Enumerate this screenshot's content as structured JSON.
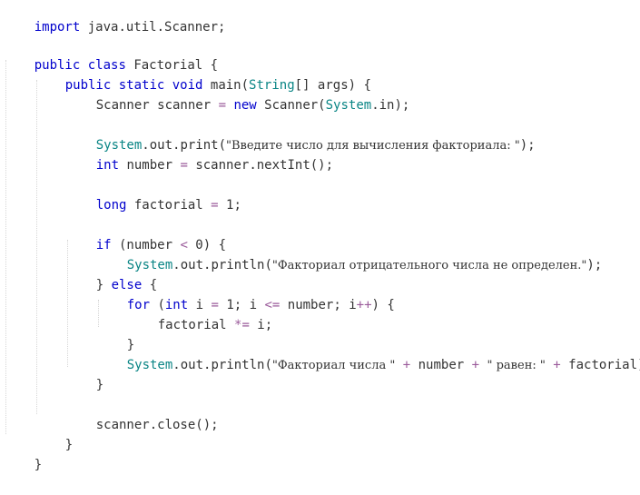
{
  "colors": {
    "keyword": "#0000cc",
    "type": "#0a8585",
    "operator": "#9a5a9a",
    "text": "#333333",
    "background": "#ffffff"
  },
  "code": {
    "l1": {
      "kw": "import",
      "rest": " java.util.Scanner;"
    },
    "l3": {
      "kw1": "public",
      "kw2": "class",
      "name": " Factorial {"
    },
    "l4": {
      "kw1": "public",
      "kw2": "static",
      "kw3": "void",
      "m": " main(",
      "type": "String",
      "rest": "[] args) {"
    },
    "l5": {
      "a": "Scanner scanner ",
      "eq": "=",
      "kw": "new",
      "b": " Scanner(",
      "sys": "System",
      "c": ".in);"
    },
    "l7": {
      "sys": "System",
      "a": ".out.print(",
      "str": "\"Введите число для вычисления факториала: \"",
      "b": ");"
    },
    "l8": {
      "kw": "int",
      "a": " number ",
      "eq": "=",
      "b": " scanner.nextInt();"
    },
    "l10": {
      "kw": "long",
      "a": " factorial ",
      "eq": "=",
      "num": " 1",
      "b": ";"
    },
    "l12": {
      "kw": "if",
      "a": " (number ",
      "op": "<",
      "num": " 0",
      "b": ") {"
    },
    "l13": {
      "sys": "System",
      "a": ".out.println(",
      "str": "\"Факториал отрицательного числа не определен.\"",
      "b": ");"
    },
    "l14": {
      "a": "} ",
      "kw": "else",
      "b": " {"
    },
    "l15": {
      "kw": "for",
      "a": " (",
      "kw2": "int",
      "b": " i ",
      "eq": "=",
      "c": " 1; i ",
      "op": "<=",
      "d": " number; i",
      "inc": "++",
      "e": ") {"
    },
    "l16": {
      "a": "factorial ",
      "op": "*=",
      "b": " i;"
    },
    "l17": {
      "a": "}"
    },
    "l18": {
      "sys": "System",
      "a": ".out.println(",
      "str1": "\"Факториал числа \"",
      "p1": " + ",
      "b": "number",
      "p2": " + ",
      "str2": "\" равен: \"",
      "p3": " + ",
      "c": "factorial);"
    },
    "l19": {
      "a": "}"
    },
    "l21": {
      "a": "scanner.close();"
    },
    "l22": {
      "a": "}"
    },
    "l23": {
      "a": "}"
    }
  }
}
